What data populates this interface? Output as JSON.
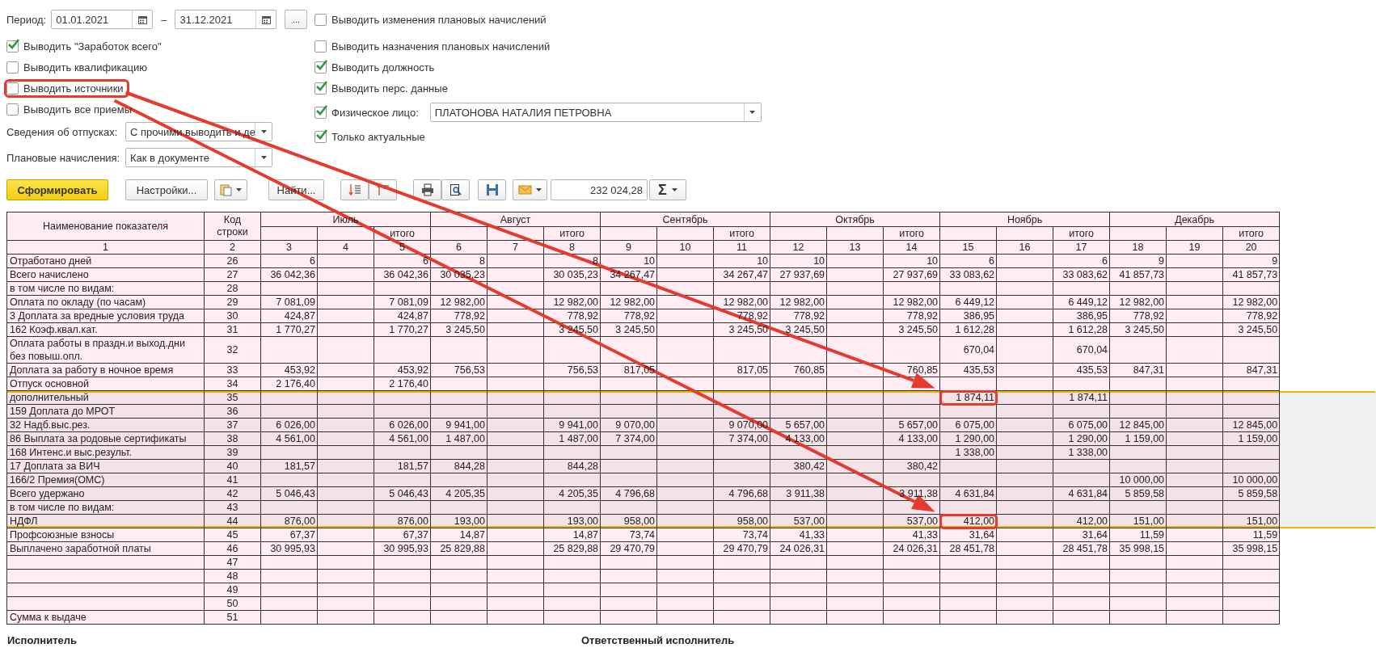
{
  "period": {
    "label": "Период:",
    "from": "01.01.2021",
    "separator": "–",
    "to": "31.12.2021",
    "more": "..."
  },
  "left_options": [
    {
      "label": "Выводить \"Заработок всего\"",
      "checked": true,
      "circled": false
    },
    {
      "label": "Выводить квалификацию",
      "checked": false,
      "circled": false
    },
    {
      "label": "Выводить источники",
      "checked": false,
      "circled": true
    },
    {
      "label": "Выводить все приемы",
      "checked": false,
      "circled": false
    }
  ],
  "vacation": {
    "label": "Сведения об отпусках:",
    "value": "С прочими выводить и де"
  },
  "planned": {
    "label": "Плановые начисления:",
    "value": "Как в документе"
  },
  "right_options": [
    {
      "kind": "plain",
      "label": "Выводить изменения плановых начислений",
      "checked": false
    },
    {
      "kind": "plain",
      "label": "Выводить назначения плановых начислений",
      "checked": false
    },
    {
      "kind": "plain",
      "label": "Выводить должность",
      "checked": true
    },
    {
      "kind": "plain",
      "label": "Выводить перс. данные",
      "checked": true
    },
    {
      "kind": "person",
      "label": "Физическое лицо:",
      "checked": true,
      "value": "ПЛАТОНОВА НАТАЛИЯ ПЕТРОВНА"
    },
    {
      "kind": "plain",
      "label": "Только актуальные",
      "checked": true
    }
  ],
  "toolbar": {
    "generate": "Сформировать",
    "settings": "Настройки...",
    "find": "Найти...",
    "sum": "232 024,28",
    "sum_symbol": "Σ"
  },
  "table": {
    "name_header": "Наименование показателя",
    "code_header": "Код строки",
    "months": [
      {
        "name": "Июль",
        "total_label": "итого"
      },
      {
        "name": "Август",
        "total_label": "итого"
      },
      {
        "name": "Сентябрь",
        "total_label": "итого"
      },
      {
        "name": "Октябрь",
        "total_label": "итого"
      },
      {
        "name": "Ноябрь",
        "total_label": "итого"
      },
      {
        "name": "Декабрь",
        "total_label": "итого"
      }
    ],
    "column_numbers": [
      "1",
      "2",
      "3",
      "4",
      "5",
      "6",
      "7",
      "8",
      "9",
      "10",
      "11",
      "12",
      "13",
      "14",
      "15",
      "16",
      "17",
      "18",
      "19",
      "20"
    ],
    "rows": [
      {
        "name": "Отработано дней",
        "code": "26",
        "selected": false,
        "cells": {
          "col_3": "6",
          "col_5": "6",
          "col_6": "8",
          "col_8": "8",
          "col_9": "10",
          "col_11": "10",
          "col_12": "10",
          "col_14": "10",
          "col_15": "6",
          "col_17": "6",
          "col_18": "9",
          "col_20": "9"
        }
      },
      {
        "name": "Всего начислено",
        "code": "27",
        "selected": false,
        "cells": {
          "col_3": "36 042,36",
          "col_5": "36 042,36",
          "col_6": "30 035,23",
          "col_8": "30 035,23",
          "col_9": "34 267,47",
          "col_11": "34 267,47",
          "col_12": "27 937,69",
          "col_14": "27 937,69",
          "col_15": "33 083,62",
          "col_17": "33 083,62",
          "col_18": "41 857,73",
          "col_20": "41 857,73"
        }
      },
      {
        "name": "в том числе по видам:",
        "code": "28",
        "selected": false
      },
      {
        "name": "Оплата по окладу (по часам)",
        "code": "29",
        "selected": false,
        "cells": {
          "col_3": "7 081,09",
          "col_5": "7 081,09",
          "col_6": "12 982,00",
          "col_8": "12 982,00",
          "col_9": "12 982,00",
          "col_11": "12 982,00",
          "col_12": "12 982,00",
          "col_14": "12 982,00",
          "col_15": "6 449,12",
          "col_17": "6 449,12",
          "col_18": "12 982,00",
          "col_20": "12 982,00"
        }
      },
      {
        "name": "3 Доплата за вредные условия труда",
        "code": "30",
        "selected": false,
        "cells": {
          "col_3": "424,87",
          "col_5": "424,87",
          "col_6": "778,92",
          "col_8": "778,92",
          "col_9": "778,92",
          "col_11": "778,92",
          "col_12": "778,92",
          "col_14": "778,92",
          "col_15": "386,95",
          "col_17": "386,95",
          "col_18": "778,92",
          "col_20": "778,92"
        }
      },
      {
        "name": "162 Коэф.квал.кат.",
        "code": "31",
        "selected": false,
        "cells": {
          "col_3": "1 770,27",
          "col_5": "1 770,27",
          "col_6": "3 245,50",
          "col_8": "3 245,50",
          "col_9": "3 245,50",
          "col_11": "3 245,50",
          "col_12": "3 245,50",
          "col_14": "3 245,50",
          "col_15": "1 612,28",
          "col_17": "1 612,28",
          "col_18": "3 245,50",
          "col_20": "3 245,50"
        }
      },
      {
        "name": "Оплата работы в праздн.и выход.дни без повыш.опл.",
        "code": "32",
        "selected": false,
        "cells": {
          "col_15": "670,04",
          "col_17": "670,04"
        }
      },
      {
        "name": "Доплата за работу в ночное время",
        "code": "33",
        "selected": false,
        "cells": {
          "col_3": "453,92",
          "col_5": "453,92",
          "col_6": "756,53",
          "col_8": "756,53",
          "col_9": "817,05",
          "col_11": "817,05",
          "col_12": "760,85",
          "col_14": "760,85",
          "col_15": "435,53",
          "col_17": "435,53",
          "col_18": "847,31",
          "col_20": "847,31"
        }
      },
      {
        "name": "Отпуск основной",
        "code": "34",
        "selected": false,
        "cells": {
          "col_3": "2 176,40",
          "col_5": "2 176,40"
        }
      },
      {
        "name": "дополнительный",
        "code": "35",
        "selected": true,
        "cells": {
          "col_15": {
            "text": "1 874,11",
            "circled": true
          },
          "col_17": "1 874,11"
        }
      },
      {
        "name": "159 Доплата до МРОТ",
        "code": "36",
        "selected": true
      },
      {
        "name": "32 Надб.выс.рез.",
        "code": "37",
        "selected": true,
        "cells": {
          "col_3": "6 026,00",
          "col_5": "6 026,00",
          "col_6": "9 941,00",
          "col_8": "9 941,00",
          "col_9": "9 070,00",
          "col_11": "9 070,00",
          "col_12": "5 657,00",
          "col_14": "5 657,00",
          "col_15": "6 075,00",
          "col_17": "6 075,00",
          "col_18": "12 845,00",
          "col_20": "12 845,00"
        }
      },
      {
        "name": "86 Выплата за родовые сертификаты",
        "code": "38",
        "selected": true,
        "cells": {
          "col_3": "4 561,00",
          "col_5": "4 561,00",
          "col_6": "1 487,00",
          "col_8": "1 487,00",
          "col_9": "7 374,00",
          "col_11": "7 374,00",
          "col_12": "4 133,00",
          "col_14": "4 133,00",
          "col_15": "1 290,00",
          "col_17": "1 290,00",
          "col_18": "1 159,00",
          "col_20": "1 159,00"
        }
      },
      {
        "name": "168 Интенс.и выс.результ.",
        "code": "39",
        "selected": true,
        "cells": {
          "col_15": "1 338,00",
          "col_17": "1 338,00"
        }
      },
      {
        "name": "17 Доплата за ВИЧ",
        "code": "40",
        "selected": true,
        "cells": {
          "col_3": "181,57",
          "col_5": "181,57",
          "col_6": "844,28",
          "col_8": "844,28",
          "col_12": "380,42",
          "col_14": "380,42"
        }
      },
      {
        "name": "166/2 Премия(ОМС)",
        "code": "41",
        "selected": true,
        "cells": {
          "col_18": "10 000,00",
          "col_20": "10 000,00"
        }
      },
      {
        "name": "Всего удержано",
        "code": "42",
        "selected": true,
        "cells": {
          "col_3": "5 046,43",
          "col_5": "5 046,43",
          "col_6": "4 205,35",
          "col_8": "4 205,35",
          "col_9": "4 796,68",
          "col_11": "4 796,68",
          "col_12": "3 911,38",
          "col_14": "3 911,38",
          "col_15": "4 631,84",
          "col_17": "4 631,84",
          "col_18": "5 859,58",
          "col_20": "5 859,58"
        }
      },
      {
        "name": "в том числе по видам:",
        "code": "43",
        "selected": true
      },
      {
        "name": "НДФЛ",
        "code": "44",
        "selected": true,
        "cells": {
          "col_3": "876,00",
          "col_5": "876,00",
          "col_6": "193,00",
          "col_8": "193,00",
          "col_9": "958,00",
          "col_11": "958,00",
          "col_12": "537,00",
          "col_14": "537,00",
          "col_15": {
            "text": "412,00",
            "circled": true
          },
          "col_17": "412,00",
          "col_18": "151,00",
          "col_20": "151,00"
        }
      },
      {
        "name": "Профсоюзные взносы",
        "code": "45",
        "selected": false,
        "cells": {
          "col_3": "67,37",
          "col_5": "67,37",
          "col_6": "14,87",
          "col_8": "14,87",
          "col_9": "73,74",
          "col_11": "73,74",
          "col_12": "41,33",
          "col_14": "41,33",
          "col_15": "31,64",
          "col_17": "31,64",
          "col_18": "11,59",
          "col_20": "11,59"
        }
      },
      {
        "name": "Выплачено заработной платы",
        "code": "46",
        "selected": false,
        "cells": {
          "col_3": "30 995,93",
          "col_5": "30 995,93",
          "col_6": "25 829,88",
          "col_8": "25 829,88",
          "col_9": "29 470,79",
          "col_11": "29 470,79",
          "col_12": "24 026,31",
          "col_14": "24 026,31",
          "col_15": "28 451,78",
          "col_17": "28 451,78",
          "col_18": "35 998,15",
          "col_20": "35 998,15"
        }
      },
      {
        "code": "47",
        "selected": false
      },
      {
        "code": "48",
        "selected": false
      },
      {
        "code": "49",
        "selected": false
      },
      {
        "code": "50",
        "selected": false
      },
      {
        "name": "Сумма к выдаче",
        "code": "51",
        "selected": false
      }
    ]
  },
  "footer": {
    "executor": "Исполнитель",
    "responsible": "Ответственный исполнитель"
  }
}
